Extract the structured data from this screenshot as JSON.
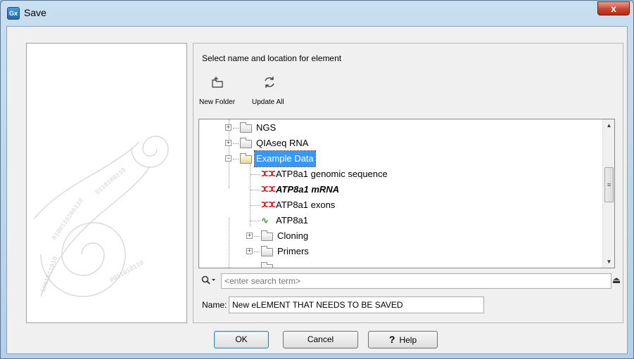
{
  "window": {
    "app_icon_text": "Gx",
    "title": "Save",
    "close_glyph": "x"
  },
  "panel": {
    "heading": "Select name and location for element"
  },
  "toolbar": {
    "new_folder_label": "New Folder",
    "new_folder_icon": "new-folder-icon",
    "update_all_label": "Update All",
    "update_all_icon": "refresh-icon"
  },
  "tree": {
    "items": [
      {
        "label": "NGS",
        "type": "folder",
        "expanded": false
      },
      {
        "label": "QIAseq RNA",
        "type": "folder",
        "expanded": false
      },
      {
        "label": "Example Data",
        "type": "folder",
        "expanded": true,
        "selected": true
      },
      {
        "label": "ATP8a1 genomic sequence",
        "type": "nucleotide-sequence"
      },
      {
        "label": "ATP8a1 mRNA",
        "type": "nucleotide-sequence",
        "style": "bold-italic"
      },
      {
        "label": "ATP8a1 exons",
        "type": "nucleotide-sequence"
      },
      {
        "label": "ATP8a1",
        "type": "protein-sequence"
      },
      {
        "label": "Cloning",
        "type": "folder",
        "expanded": false
      },
      {
        "label": "Primers",
        "type": "folder",
        "expanded": false
      }
    ]
  },
  "search": {
    "placeholder": "<enter search term>",
    "value": ""
  },
  "name_field": {
    "label": "Name:",
    "value": "New eLEMENT THAT NEEDS TO BE SAVED"
  },
  "buttons": {
    "ok": "OK",
    "cancel": "Cancel",
    "help": "Help",
    "help_glyph": "?"
  },
  "colors": {
    "selection": "#3399ff",
    "sequence_icon": "#cc2222",
    "protein_icon": "#2a9a2a",
    "close_button": "#c8462f"
  }
}
